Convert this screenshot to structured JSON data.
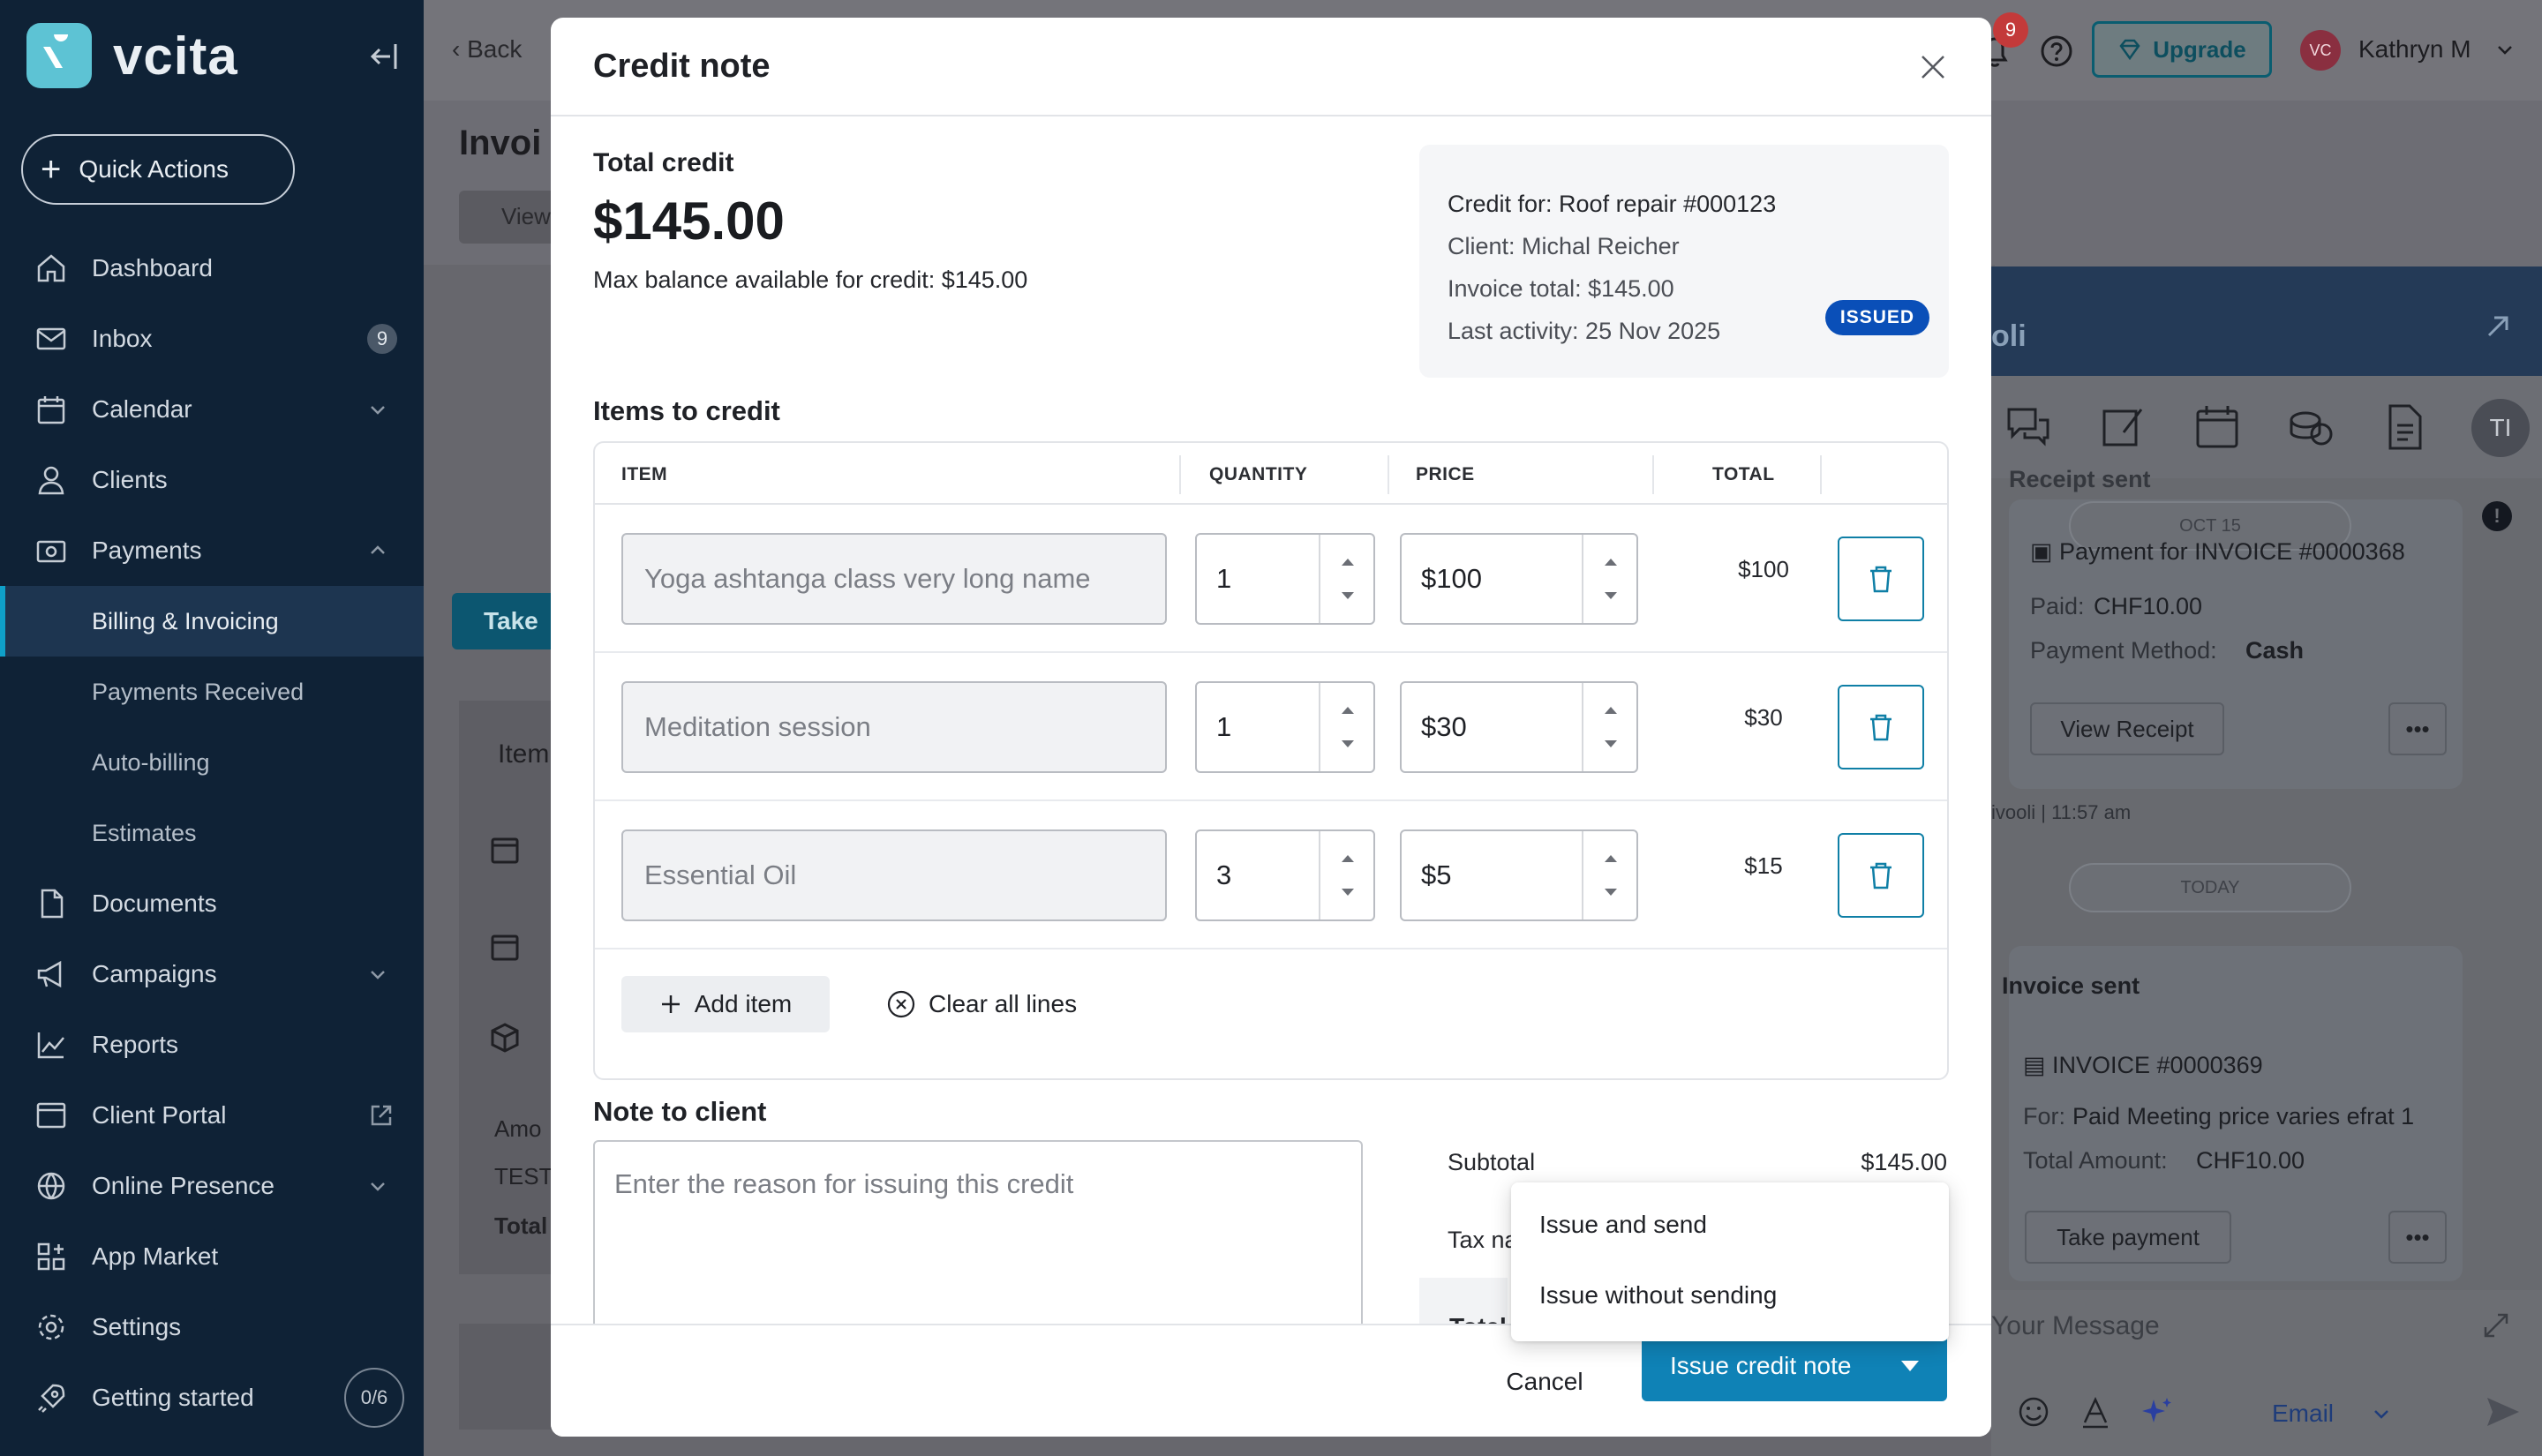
{
  "sidebar": {
    "brand": "vcita",
    "quick_actions": "Quick Actions",
    "items": [
      {
        "label": "Dashboard"
      },
      {
        "label": "Inbox",
        "count": "9"
      },
      {
        "label": "Calendar"
      },
      {
        "label": "Clients"
      },
      {
        "label": "Payments"
      },
      {
        "label": "Billing & Invoicing"
      },
      {
        "label": "Payments Received"
      },
      {
        "label": "Auto-billing"
      },
      {
        "label": "Estimates"
      },
      {
        "label": "Documents"
      },
      {
        "label": "Campaigns"
      },
      {
        "label": "Reports"
      },
      {
        "label": "Client Portal"
      },
      {
        "label": "Online Presence"
      },
      {
        "label": "App Market"
      },
      {
        "label": "Settings"
      },
      {
        "label": "Getting started",
        "progress": "0/6"
      }
    ]
  },
  "topbar": {
    "back": "Back",
    "notifications": "9",
    "upgrade": "Upgrade",
    "avatar": "VC",
    "user": "Kathryn M"
  },
  "background": {
    "page_title": "Invoi",
    "view_tab": "View",
    "take_button": "Take",
    "items_label": "Item",
    "amount": "Amo",
    "test": "TEST",
    "total": "Total"
  },
  "chat": {
    "name": "oli",
    "avatar": "TI",
    "date_1": "OCT 15",
    "receipt_title": "Payment for INVOICE #0000368",
    "receipt_header": "Receipt sent",
    "paid_label": "Paid:",
    "paid_value": "CHF10.00",
    "method_label": "Payment Method:",
    "method_value": "Cash",
    "view_receipt": "View Receipt",
    "meta_1": "ivooli | 11:57 am",
    "date_2": "TODAY",
    "invoice_sent": "Invoice sent",
    "invoice_number": "INVOICE #0000369",
    "for_label": "For:",
    "for_value": "Paid Meeting price varies efrat 1",
    "total_label": "Total Amount:",
    "total_value": "CHF10.00",
    "take_payment": "Take payment",
    "message_placeholder": "Your Message",
    "channel": "Email"
  },
  "modal": {
    "title": "Credit note",
    "total_label": "Total credit",
    "total_value": "$145.00",
    "max_balance": "Max balance available for credit: $145.00",
    "info": {
      "credit_for": "Credit for: Roof repair  #000123",
      "client": "Client: Michal Reicher",
      "invoice_total": "Invoice total: $145.00",
      "last_activity": "Last activity: 25 Nov 2025",
      "status": "ISSUED"
    },
    "items_heading": "Items to credit",
    "columns": [
      "ITEM",
      "QUANTITY",
      "PRICE",
      "TOTAL"
    ],
    "items": [
      {
        "name": "Yoga ashtanga class very long name",
        "qty": "1",
        "price": "$100",
        "total": "$100"
      },
      {
        "name": "Meditation session",
        "qty": "1",
        "price": "$30",
        "total": "$30"
      },
      {
        "name": "Essential Oil",
        "qty": "3",
        "price": "$5",
        "total": "$15"
      }
    ],
    "add_item": "Add item",
    "clear_lines": "Clear all lines",
    "note_heading": "Note to client",
    "note_placeholder": "Enter the reason for issuing this credit",
    "subtotal_label": "Subtotal",
    "subtotal_value": "$145.00",
    "tax_label": "Tax na",
    "total_row_label": "Total",
    "cancel": "Cancel",
    "issue": "Issue credit note",
    "dropdown": [
      "Issue and send",
      "Issue without sending"
    ]
  },
  "colors": {
    "sidebar_bg": "#0f2236",
    "accent": "#0f82b6",
    "issued_badge": "#0a4fb8"
  }
}
